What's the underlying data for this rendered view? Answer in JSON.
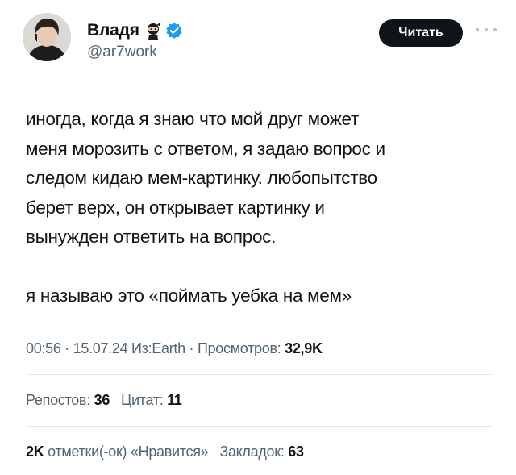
{
  "author": {
    "display_name": "Владя",
    "handle": "@ar7work",
    "avatar_icon": "avatar-photo",
    "badge_emoji_icon": "ninja-icon",
    "verified_icon": "verified-badge-icon",
    "verified_color": "#1d9bf0"
  },
  "follow_button": {
    "label": "Читать"
  },
  "tweet": {
    "text": "иногда, когда я знаю что мой друг может\nменя морозить с ответом, я задаю вопрос и\nследом кидаю мем-картинку. любопытство\nберет верх, он открывает картинку и\nвынужден ответить на вопрос.\n\nя называю это «поймать уебка на мем»"
  },
  "meta": {
    "time": "00:56",
    "sep1": " · ",
    "date": "15.07.24",
    "source": " Из:Earth",
    "sep2": " · ",
    "views_label": "Просмотров: ",
    "views_value": "32,9K"
  },
  "stats": {
    "reposts_label": "Репостов: ",
    "reposts_value": "36",
    "quotes_label": "Цитат: ",
    "quotes_value": "11",
    "likes_value": "2K",
    "likes_label": " отметки(-ок) «Нравится»",
    "bookmarks_label": "Закладок: ",
    "bookmarks_value": "63"
  }
}
